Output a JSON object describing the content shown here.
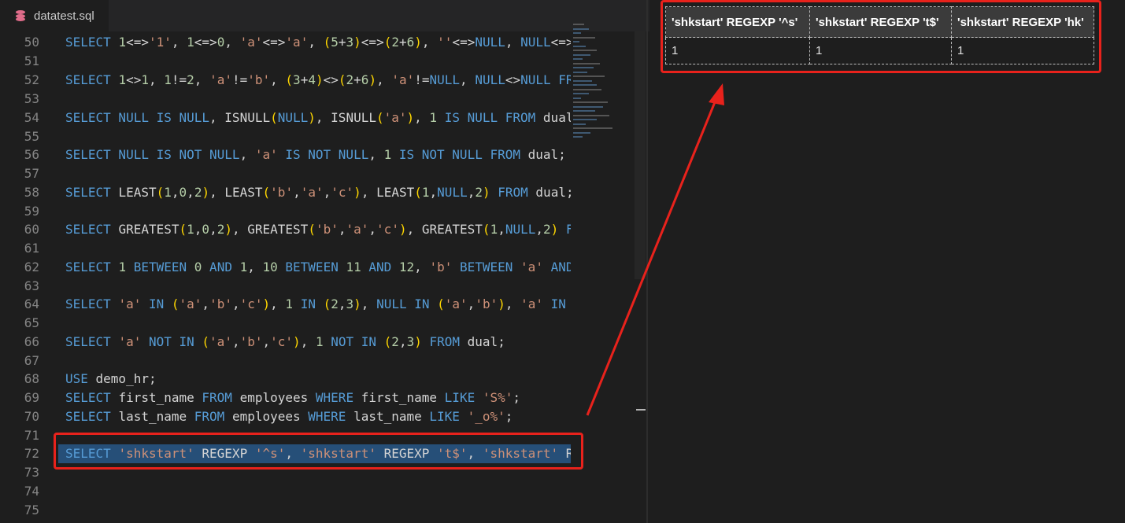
{
  "tab": {
    "filename": "datatest.sql",
    "icon": "database-icon"
  },
  "editor": {
    "lines": [
      {
        "n": "50",
        "tokens": [
          [
            "kw",
            "SELECT "
          ],
          [
            "num",
            "1"
          ],
          [
            "",
            "<=>"
          ],
          [
            "str",
            "'1'"
          ],
          [
            "",
            ", "
          ],
          [
            "num",
            "1"
          ],
          [
            "",
            "<=>"
          ],
          [
            "num",
            "0"
          ],
          [
            "",
            ", "
          ],
          [
            "str",
            "'a'"
          ],
          [
            "",
            "<=>"
          ],
          [
            "str",
            "'a'"
          ],
          [
            "",
            ", "
          ],
          [
            "p1",
            "("
          ],
          [
            "num",
            "5"
          ],
          [
            "",
            "+"
          ],
          [
            "num",
            "3"
          ],
          [
            "p1",
            ")"
          ],
          [
            "",
            "<=>"
          ],
          [
            "p1",
            "("
          ],
          [
            "num",
            "2"
          ],
          [
            "",
            "+"
          ],
          [
            "num",
            "6"
          ],
          [
            "p1",
            ")"
          ],
          [
            "",
            ", "
          ],
          [
            "str",
            "''"
          ],
          [
            "",
            "<=>"
          ],
          [
            "kw",
            "NULL"
          ],
          [
            "",
            ", "
          ],
          [
            "kw",
            "NULL"
          ],
          [
            "",
            "<=>"
          ]
        ]
      },
      {
        "n": "51",
        "tokens": []
      },
      {
        "n": "52",
        "tokens": [
          [
            "kw",
            "SELECT "
          ],
          [
            "num",
            "1"
          ],
          [
            "",
            "<>"
          ],
          [
            "num",
            "1"
          ],
          [
            "",
            ", "
          ],
          [
            "num",
            "1"
          ],
          [
            "",
            "!="
          ],
          [
            "num",
            "2"
          ],
          [
            "",
            ", "
          ],
          [
            "str",
            "'a'"
          ],
          [
            "",
            "!="
          ],
          [
            "str",
            "'b'"
          ],
          [
            "",
            ", "
          ],
          [
            "p1",
            "("
          ],
          [
            "num",
            "3"
          ],
          [
            "",
            "+"
          ],
          [
            "num",
            "4"
          ],
          [
            "p1",
            ")"
          ],
          [
            "",
            "<>"
          ],
          [
            "p1",
            "("
          ],
          [
            "num",
            "2"
          ],
          [
            "",
            "+"
          ],
          [
            "num",
            "6"
          ],
          [
            "p1",
            ")"
          ],
          [
            "",
            ", "
          ],
          [
            "str",
            "'a'"
          ],
          [
            "",
            "!="
          ],
          [
            "kw",
            "NULL"
          ],
          [
            "",
            ", "
          ],
          [
            "kw",
            "NULL"
          ],
          [
            "",
            "<>"
          ],
          [
            "kw",
            "NULL "
          ],
          [
            "kw",
            "FR"
          ]
        ]
      },
      {
        "n": "53",
        "tokens": []
      },
      {
        "n": "54",
        "tokens": [
          [
            "kw",
            "SELECT NULL IS NULL"
          ],
          [
            "",
            ", ISNULL"
          ],
          [
            "p1",
            "("
          ],
          [
            "kw",
            "NULL"
          ],
          [
            "p1",
            ")"
          ],
          [
            "",
            ", ISNULL"
          ],
          [
            "p1",
            "("
          ],
          [
            "str",
            "'a'"
          ],
          [
            "p1",
            ")"
          ],
          [
            "",
            ", "
          ],
          [
            "num",
            "1"
          ],
          [
            "kw",
            " IS NULL FROM "
          ],
          [
            "",
            "dual"
          ]
        ]
      },
      {
        "n": "55",
        "tokens": []
      },
      {
        "n": "56",
        "tokens": [
          [
            "kw",
            "SELECT NULL IS NOT NULL"
          ],
          [
            "",
            ", "
          ],
          [
            "str",
            "'a'"
          ],
          [
            "kw",
            " IS NOT NULL"
          ],
          [
            "",
            ", "
          ],
          [
            "num",
            "1"
          ],
          [
            "kw",
            " IS NOT NULL FROM "
          ],
          [
            "",
            "dual;"
          ]
        ]
      },
      {
        "n": "57",
        "tokens": []
      },
      {
        "n": "58",
        "tokens": [
          [
            "kw",
            "SELECT "
          ],
          [
            "",
            "LEAST"
          ],
          [
            "p1",
            "("
          ],
          [
            "num",
            "1"
          ],
          [
            "",
            ","
          ],
          [
            "num",
            "0"
          ],
          [
            "",
            ","
          ],
          [
            "num",
            "2"
          ],
          [
            "p1",
            ")"
          ],
          [
            "",
            ", LEAST"
          ],
          [
            "p1",
            "("
          ],
          [
            "str",
            "'b'"
          ],
          [
            "",
            ","
          ],
          [
            "str",
            "'a'"
          ],
          [
            "",
            ","
          ],
          [
            "str",
            "'c'"
          ],
          [
            "p1",
            ")"
          ],
          [
            "",
            ", LEAST"
          ],
          [
            "p1",
            "("
          ],
          [
            "num",
            "1"
          ],
          [
            "",
            ","
          ],
          [
            "kw",
            "NULL"
          ],
          [
            "",
            ","
          ],
          [
            "num",
            "2"
          ],
          [
            "p1",
            ")"
          ],
          [
            "kw",
            " FROM "
          ],
          [
            "",
            "dual;"
          ]
        ]
      },
      {
        "n": "59",
        "tokens": []
      },
      {
        "n": "60",
        "tokens": [
          [
            "kw",
            "SELECT "
          ],
          [
            "",
            "GREATEST"
          ],
          [
            "p1",
            "("
          ],
          [
            "num",
            "1"
          ],
          [
            "",
            ","
          ],
          [
            "num",
            "0"
          ],
          [
            "",
            ","
          ],
          [
            "num",
            "2"
          ],
          [
            "p1",
            ")"
          ],
          [
            "",
            ", GREATEST"
          ],
          [
            "p1",
            "("
          ],
          [
            "str",
            "'b'"
          ],
          [
            "",
            ","
          ],
          [
            "str",
            "'a'"
          ],
          [
            "",
            ","
          ],
          [
            "str",
            "'c'"
          ],
          [
            "p1",
            ")"
          ],
          [
            "",
            ", GREATEST"
          ],
          [
            "p1",
            "("
          ],
          [
            "num",
            "1"
          ],
          [
            "",
            ","
          ],
          [
            "kw",
            "NULL"
          ],
          [
            "",
            ","
          ],
          [
            "num",
            "2"
          ],
          [
            "p1",
            ")"
          ],
          [
            "kw",
            " F"
          ]
        ]
      },
      {
        "n": "61",
        "tokens": []
      },
      {
        "n": "62",
        "tokens": [
          [
            "kw",
            "SELECT "
          ],
          [
            "num",
            "1"
          ],
          [
            "kw",
            " BETWEEN "
          ],
          [
            "num",
            "0"
          ],
          [
            "kw",
            " AND "
          ],
          [
            "num",
            "1"
          ],
          [
            "",
            ", "
          ],
          [
            "num",
            "10"
          ],
          [
            "kw",
            " BETWEEN "
          ],
          [
            "num",
            "11"
          ],
          [
            "kw",
            " AND "
          ],
          [
            "num",
            "12"
          ],
          [
            "",
            ", "
          ],
          [
            "str",
            "'b'"
          ],
          [
            "kw",
            " BETWEEN "
          ],
          [
            "str",
            "'a'"
          ],
          [
            "kw",
            " AND"
          ]
        ]
      },
      {
        "n": "63",
        "tokens": []
      },
      {
        "n": "64",
        "tokens": [
          [
            "kw",
            "SELECT "
          ],
          [
            "str",
            "'a'"
          ],
          [
            "kw",
            " IN "
          ],
          [
            "p1",
            "("
          ],
          [
            "str",
            "'a'"
          ],
          [
            "",
            ","
          ],
          [
            "str",
            "'b'"
          ],
          [
            "",
            ","
          ],
          [
            "str",
            "'c'"
          ],
          [
            "p1",
            ")"
          ],
          [
            "",
            ", "
          ],
          [
            "num",
            "1"
          ],
          [
            "kw",
            " IN "
          ],
          [
            "p1",
            "("
          ],
          [
            "num",
            "2"
          ],
          [
            "",
            ","
          ],
          [
            "num",
            "3"
          ],
          [
            "p1",
            ")"
          ],
          [
            "",
            ", "
          ],
          [
            "kw",
            "NULL IN "
          ],
          [
            "p1",
            "("
          ],
          [
            "str",
            "'a'"
          ],
          [
            "",
            ","
          ],
          [
            "str",
            "'b'"
          ],
          [
            "p1",
            ")"
          ],
          [
            "",
            ", "
          ],
          [
            "str",
            "'a'"
          ],
          [
            "kw",
            " IN"
          ]
        ]
      },
      {
        "n": "65",
        "tokens": []
      },
      {
        "n": "66",
        "tokens": [
          [
            "kw",
            "SELECT "
          ],
          [
            "str",
            "'a'"
          ],
          [
            "kw",
            " NOT IN "
          ],
          [
            "p1",
            "("
          ],
          [
            "str",
            "'a'"
          ],
          [
            "",
            ","
          ],
          [
            "str",
            "'b'"
          ],
          [
            "",
            ","
          ],
          [
            "str",
            "'c'"
          ],
          [
            "p1",
            ")"
          ],
          [
            "",
            ", "
          ],
          [
            "num",
            "1"
          ],
          [
            "kw",
            " NOT IN "
          ],
          [
            "p1",
            "("
          ],
          [
            "num",
            "2"
          ],
          [
            "",
            ","
          ],
          [
            "num",
            "3"
          ],
          [
            "p1",
            ")"
          ],
          [
            "kw",
            " FROM "
          ],
          [
            "",
            "dual;"
          ]
        ]
      },
      {
        "n": "67",
        "tokens": []
      },
      {
        "n": "68",
        "tokens": [
          [
            "kw",
            "USE "
          ],
          [
            "",
            "demo_hr;"
          ]
        ]
      },
      {
        "n": "69",
        "tokens": [
          [
            "kw",
            "SELECT "
          ],
          [
            "",
            "first_name "
          ],
          [
            "kw",
            "FROM "
          ],
          [
            "",
            "employees "
          ],
          [
            "kw",
            "WHERE "
          ],
          [
            "",
            "first_name "
          ],
          [
            "kw",
            "LIKE "
          ],
          [
            "str",
            "'S%'"
          ],
          [
            "",
            ";"
          ]
        ]
      },
      {
        "n": "70",
        "tokens": [
          [
            "kw",
            "SELECT "
          ],
          [
            "",
            "last_name "
          ],
          [
            "kw",
            "FROM "
          ],
          [
            "",
            "employees "
          ],
          [
            "kw",
            "WHERE "
          ],
          [
            "",
            "last_name "
          ],
          [
            "kw",
            "LIKE "
          ],
          [
            "str",
            "'_o%'"
          ],
          [
            "",
            ";"
          ]
        ]
      },
      {
        "n": "71",
        "tokens": []
      },
      {
        "n": "72",
        "tokens": [
          [
            "kw",
            "SELECT "
          ],
          [
            "str",
            "'shkstart'"
          ],
          [
            "",
            " REGEXP "
          ],
          [
            "str",
            "'^s'"
          ],
          [
            "",
            ", "
          ],
          [
            "str",
            "'shkstart'"
          ],
          [
            "",
            " REGEXP "
          ],
          [
            "str",
            "'t$'"
          ],
          [
            "",
            ", "
          ],
          [
            "str",
            "'shkstart'"
          ],
          [
            "",
            " R"
          ]
        ]
      },
      {
        "n": "73",
        "tokens": []
      },
      {
        "n": "74",
        "tokens": []
      },
      {
        "n": "75",
        "tokens": []
      }
    ]
  },
  "result": {
    "columns": [
      "'shkstart' REGEXP '^s'",
      "'shkstart' REGEXP 't$'",
      "'shkstart' REGEXP 'hk'"
    ],
    "rows": [
      [
        "1",
        "1",
        "1"
      ]
    ]
  },
  "colors": {
    "highlight": "#e8221c",
    "selection": "#264f78"
  }
}
